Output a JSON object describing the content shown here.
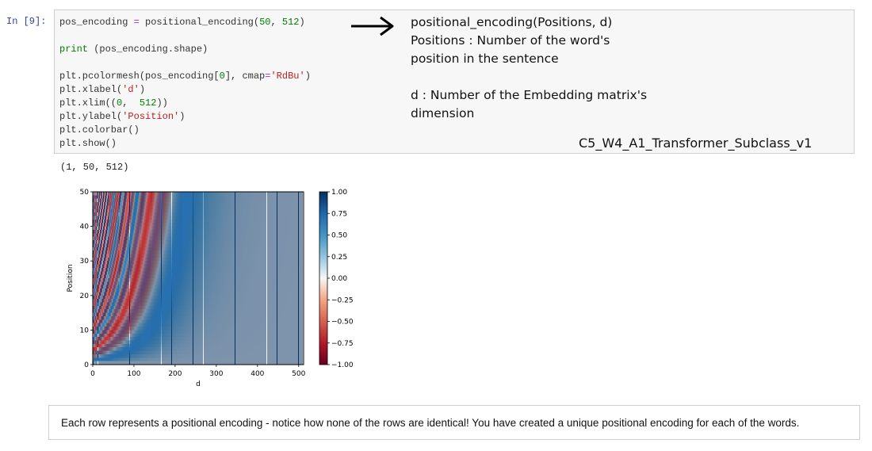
{
  "cell": {
    "prompt": "In [9]:",
    "code": {
      "l1_var": "pos_encoding",
      "l1_eq": " = ",
      "l1_call": "positional_encoding(",
      "l1_n1": "50",
      "l1_sep": ", ",
      "l1_n2": "512",
      "l1_end": ")",
      "l2_print": "print",
      "l2_rest": " (pos_encoding.shape)",
      "l3a": "plt.pcolormesh(pos_encoding[",
      "l3_idx": "0",
      "l3b": "], cmap",
      "l3_eq": "=",
      "l3_str": "'RdBu'",
      "l3c": ")",
      "l4a": "plt.xlabel(",
      "l4_str": "'d'",
      "l4b": ")",
      "l5a": "plt.xlim((",
      "l5_n1": "0",
      "l5_sep": ",  ",
      "l5_n2": "512",
      "l5b": "))",
      "l6a": "plt.ylabel(",
      "l6_str": "'Position'",
      "l6b": ")",
      "l7": "plt.colorbar()",
      "l8": "plt.show()"
    }
  },
  "annotation": {
    "line1": "positional_encoding(Positions, d)",
    "line2": "Positions : Number of the word's",
    "line3": "position in the sentence",
    "line4": "d : Number of the Embedding matrix's",
    "line5": "dimension",
    "tag": "C5_W4_A1_Transformer_Subclass_v1"
  },
  "output": {
    "shape": "(1, 50, 512)"
  },
  "chart_data": {
    "type": "heatmap",
    "xlabel": "d",
    "ylabel": "Position",
    "x_ticks": [
      "0",
      "100",
      "200",
      "300",
      "400",
      "500"
    ],
    "y_ticks": [
      "0",
      "10",
      "20",
      "30",
      "40",
      "50"
    ],
    "xlim": [
      0,
      512
    ],
    "ylim": [
      0,
      50
    ],
    "colormap": "RdBu",
    "colorbar_ticks": [
      "1.00",
      "0.75",
      "0.50",
      "0.25",
      "0.00",
      "−0.25",
      "−0.50",
      "−0.75",
      "−1.00"
    ],
    "colorbar_range": [
      -1,
      1
    ],
    "positions": 50,
    "d_model": 512
  },
  "markdown": {
    "text": "Each row represents a positional encoding - notice how none of the rows are identical! You have created a unique positional encoding for each of the words."
  },
  "colors": {
    "prompt": "#303f9f",
    "cell_bg": "#f7f7f7",
    "cell_border": "#cfcfcf",
    "string": "#ba2121",
    "number": "#008000",
    "operator": "#aa22ff"
  }
}
